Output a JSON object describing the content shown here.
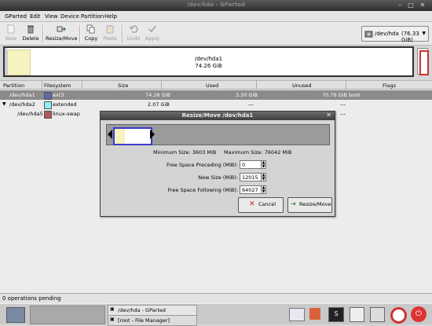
{
  "window": {
    "title": "/dev/hda - GParted"
  },
  "menu": [
    "GParted",
    "Edit",
    "View",
    "Device",
    "Partition",
    "Help"
  ],
  "toolbar": {
    "new": "New",
    "delete": "Delete",
    "resize_move": "Resize/Move",
    "copy": "Copy",
    "paste": "Paste",
    "undo": "Undo",
    "apply": "Apply"
  },
  "device_selector": {
    "device": "/dev/hda",
    "size": "(76.33 GiB)"
  },
  "disk_map": {
    "name": "/dev/hda1",
    "size": "74.26 GiB"
  },
  "table": {
    "headers": [
      "Partition",
      "Filesystem",
      "Size",
      "Used",
      "Unused",
      "Flags"
    ],
    "rows": [
      {
        "partition": "/dev/hda1",
        "filesystem": "ext3",
        "size": "74.26 GiB",
        "used": "3.50 GiB",
        "unused": "70.76 GiB",
        "flags": "boot",
        "color": "#5d6aa8"
      },
      {
        "partition": "/dev/hda2",
        "filesystem": "extended",
        "size": "2.07 GiB",
        "used": "---",
        "unused": "---",
        "flags": "",
        "color": "#8ff0f0"
      },
      {
        "partition": "/dev/hda5",
        "filesystem": "linux-swap",
        "size": "",
        "used": "",
        "unused": "---",
        "flags": "",
        "color": "#b05a5a"
      }
    ]
  },
  "dialog": {
    "title": "Resize/Move /dev/hda1",
    "min_size": "Minimum Size: 3603 MiB",
    "max_size": "Maximum Size: 76042 MiB",
    "fields": [
      {
        "label": "Free Space Preceding (MiB):",
        "value": "0"
      },
      {
        "label": "New Size (MiB):",
        "value": "12015"
      },
      {
        "label": "Free Space Following (MiB):",
        "value": "64027"
      }
    ],
    "cancel": "Cancel",
    "resize_move": "Resize/Move"
  },
  "status": "0 operations pending",
  "taskbar": {
    "task1": "/dev/hda - GParted",
    "task2": "[root - File Manager]"
  },
  "colors": {
    "selected_row": "#8b8b8b",
    "partition_border": "#3a3ac9",
    "used_space": "#f7f3c0"
  }
}
